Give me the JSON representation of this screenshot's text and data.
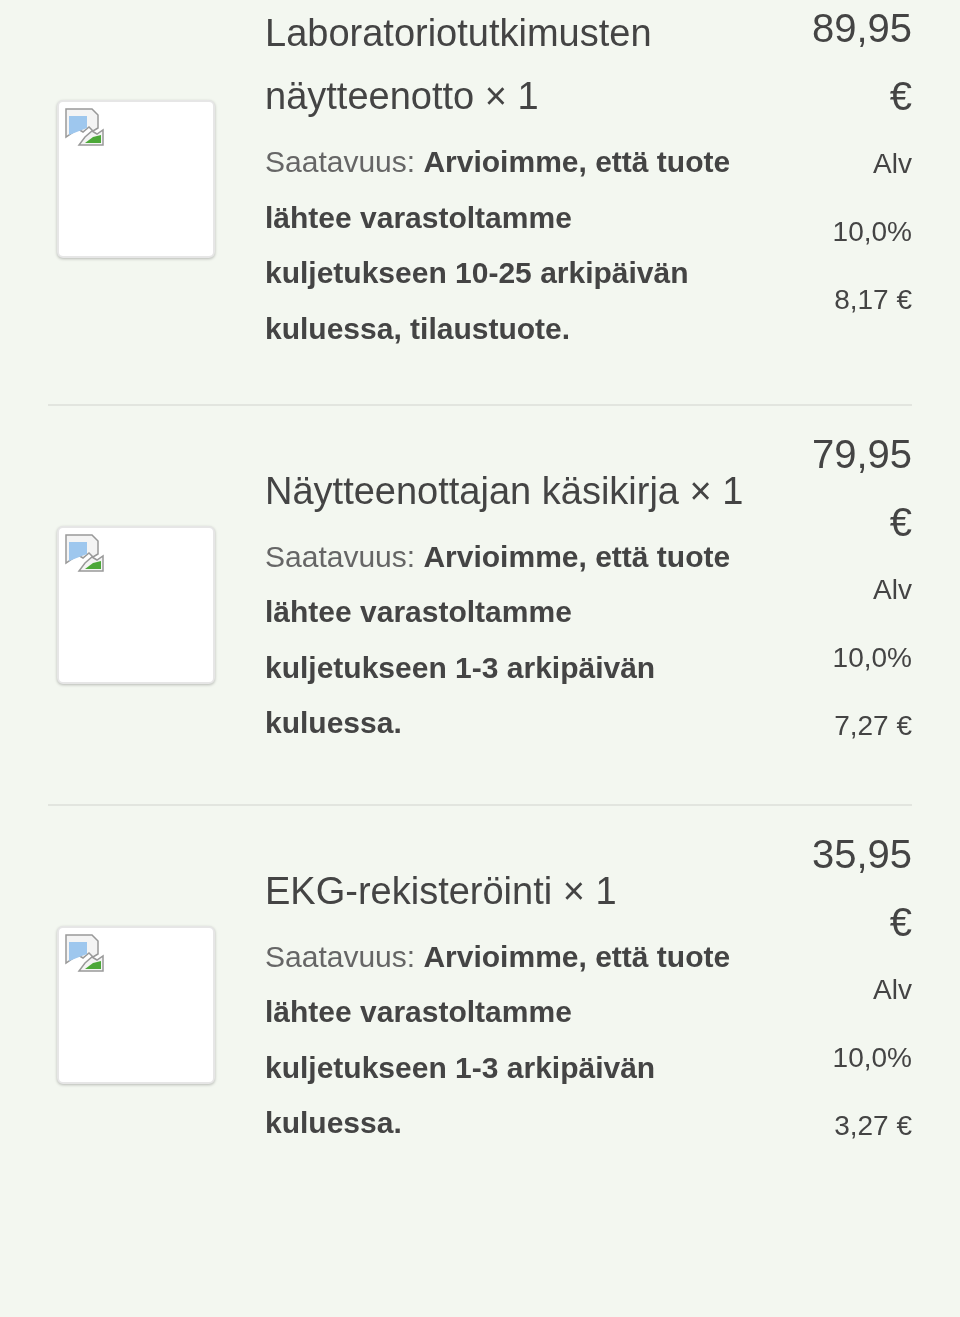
{
  "items": [
    {
      "title": "Laboratoriotutkimusten näytteenotto × 1",
      "availability": "Saatavuus: **Arvioimme, että tuote lähtee varastoltamme kuljetukseen 10-25 arkipäivän kuluessa, tilaustuote.**",
      "price": "89,95 €",
      "vat_label": "Alv",
      "vat_rate": "10,0%",
      "vat_amount": "8,17 €"
    },
    {
      "title": "Näytteenottajan käsikirja × 1",
      "availability": "Saatavuus: **Arvioimme, että tuote lähtee varastoltamme kuljetukseen 1-3 arkipäivän kuluessa.**",
      "price": "79,95 €",
      "vat_label": "Alv",
      "vat_rate": "10,0%",
      "vat_amount": "7,27 €"
    },
    {
      "title": "EKG-rekisteröinti × 1",
      "availability": "Saatavuus: **Arvioimme, että tuote lähtee varastoltamme kuljetukseen 1-3 arkipäivän kuluessa.**",
      "price": "35,95 €",
      "vat_label": "Alv",
      "vat_rate": "10,0%",
      "vat_amount": "3,27 €"
    }
  ]
}
